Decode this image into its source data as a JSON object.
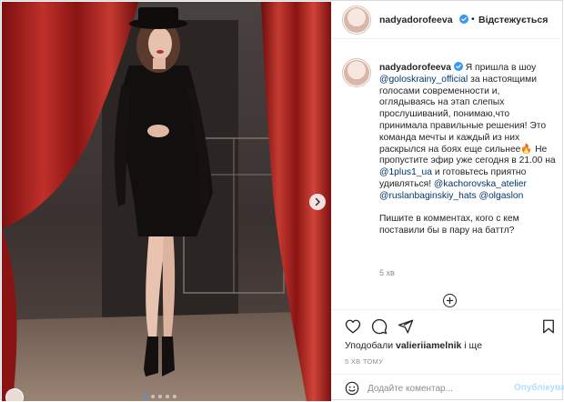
{
  "post": {
    "username": "nadyadorofeeva",
    "follow_label": "Відстежується",
    "separator": "•",
    "caption": {
      "author": "nadyadorofeeva",
      "segments": [
        {
          "text": "Я пришла в шоу ",
          "link": false
        },
        {
          "text": "@goloskrainy_official",
          "link": true
        },
        {
          "text": " за настоящими голосами современности и, оглядываясь на этап слепых прослушиваний, понимаю,что принимала правильные решения! Это команда мечты и каждый из них раскрылся на боях еще сильнее🔥 Не пропустите эфир уже сегодня в 21.00 на ",
          "link": false
        },
        {
          "text": "@1plus1_ua",
          "link": true
        },
        {
          "text": " и готовьтесь приятно удивляться! ",
          "link": false
        },
        {
          "text": "@kachorovska_atelier",
          "link": true
        },
        {
          "text": " ",
          "link": false
        },
        {
          "text": "@ruslanbaginskiy_hats",
          "link": true
        },
        {
          "text": " ",
          "link": false
        },
        {
          "text": "@olgaslon",
          "link": true
        }
      ],
      "second_paragraph": "Пишите в комментах, кого с кем поставили бы в пару на баттл?"
    },
    "caption_time": "5 хв",
    "likes": {
      "prefix": "Уподобали ",
      "user": "valieriiamelnik",
      "suffix": " і ще"
    },
    "time_ago": "5 ХВ ТОМУ",
    "comment": {
      "placeholder": "Додайте коментар...",
      "publish_label": "Опублікувати"
    },
    "carousel": {
      "total": 5,
      "active": 0
    },
    "icons": {
      "verified": "verified-badge-icon",
      "like": "heart-icon",
      "comment": "comment-icon",
      "share": "share-icon",
      "save": "bookmark-icon",
      "emoji": "emoji-icon",
      "next": "chevron-right-icon",
      "load_more": "plus-circle-icon"
    },
    "colors": {
      "link": "#00376b",
      "verified": "#3897f0",
      "publish_disabled": "#b2dffc",
      "curtain": "#b3201f"
    }
  }
}
